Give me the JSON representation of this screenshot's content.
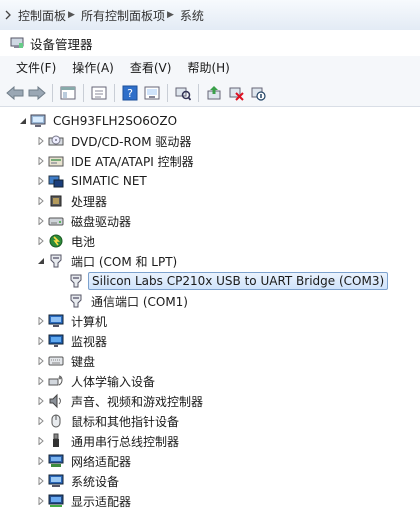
{
  "address": {
    "crumbs": [
      "控制面板",
      "所有控制面板项",
      "系统"
    ]
  },
  "window": {
    "title": "设备管理器"
  },
  "menu": [
    "文件(F)",
    "操作(A)",
    "查看(V)",
    "帮助(H)"
  ],
  "toolbar": {
    "buttons": [
      "back-icon",
      "forward-icon",
      "show-hide-console-tree-icon",
      "properties-icon",
      "help-icon",
      "device-properties-icon",
      "scan-hardware-icon",
      "update-driver-icon",
      "uninstall-device-icon",
      "disable-device-icon"
    ]
  },
  "tree": {
    "root": "CGH93FLH2SO6OZO",
    "categories": [
      {
        "label": "DVD/CD-ROM 驱动器",
        "icon": "dvd-drive-icon",
        "expanded": false
      },
      {
        "label": "IDE ATA/ATAPI 控制器",
        "icon": "ide-controller-icon",
        "expanded": false
      },
      {
        "label": "SIMATIC NET",
        "icon": "simatic-net-icon",
        "expanded": false
      },
      {
        "label": "处理器",
        "icon": "processor-icon",
        "expanded": false
      },
      {
        "label": "磁盘驱动器",
        "icon": "disk-drive-icon",
        "expanded": false
      },
      {
        "label": "电池",
        "icon": "battery-icon",
        "expanded": false
      },
      {
        "label": "端口 (COM 和 LPT)",
        "icon": "port-icon",
        "expanded": true,
        "children": [
          {
            "label": "Silicon Labs CP210x USB to UART Bridge (COM3)",
            "icon": "port-icon",
            "selected": true
          },
          {
            "label": "通信端口 (COM1)",
            "icon": "port-icon",
            "selected": false
          }
        ]
      },
      {
        "label": "计算机",
        "icon": "computer-icon",
        "expanded": false
      },
      {
        "label": "监视器",
        "icon": "monitor-icon",
        "expanded": false
      },
      {
        "label": "键盘",
        "icon": "keyboard-icon",
        "expanded": false
      },
      {
        "label": "人体学输入设备",
        "icon": "hid-icon",
        "expanded": false
      },
      {
        "label": "声音、视频和游戏控制器",
        "icon": "sound-icon",
        "expanded": false
      },
      {
        "label": "鼠标和其他指针设备",
        "icon": "mouse-icon",
        "expanded": false
      },
      {
        "label": "通用串行总线控制器",
        "icon": "usb-icon",
        "expanded": false
      },
      {
        "label": "网络适配器",
        "icon": "network-adapter-icon",
        "expanded": false
      },
      {
        "label": "系统设备",
        "icon": "system-device-icon",
        "expanded": false
      },
      {
        "label": "显示适配器",
        "icon": "display-adapter-icon",
        "expanded": false
      }
    ]
  },
  "colors": {
    "selection_border": "#7da2ce",
    "selection_fill": "#cfe3fb",
    "chrome": "#f5f7fa"
  }
}
